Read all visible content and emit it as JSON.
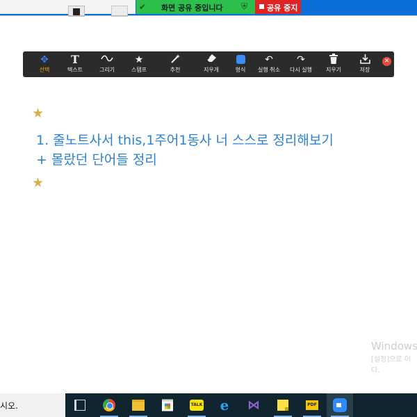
{
  "top_bar": {
    "share_status": "화면 공유 중입니다",
    "stop_share_label": "공유 중지",
    "colors": {
      "share_green": "#2dbf4b",
      "stop_red": "#e02424",
      "window_blue": "#0a6fd8"
    }
  },
  "toolbar": {
    "tools": [
      {
        "name": "tool-select",
        "icon": "move-icon",
        "label": "선택",
        "active": true
      },
      {
        "name": "tool-text",
        "icon": "text-t-icon",
        "label": "텍스트"
      },
      {
        "name": "tool-draw",
        "icon": "squiggle-icon",
        "label": "그리기"
      },
      {
        "name": "tool-stamp",
        "icon": "star-icon",
        "label": "스탬프"
      },
      {
        "name": "tool-spotlight",
        "icon": "wand-icon",
        "label": "추천"
      },
      {
        "name": "tool-eraser",
        "icon": "eraser-icon",
        "label": "지우개"
      },
      {
        "name": "tool-format",
        "icon": "color-square-icon",
        "label": "형식"
      },
      {
        "name": "tool-undo",
        "icon": "undo-icon",
        "label": "실행 취소"
      },
      {
        "name": "tool-redo",
        "icon": "redo-icon",
        "label": "다시 실행"
      },
      {
        "name": "tool-clear",
        "icon": "trash-icon",
        "label": "지우기"
      },
      {
        "name": "tool-save",
        "icon": "download-icon",
        "label": "저장"
      }
    ],
    "close_icon": "close-icon",
    "accent_color": "#f4a31c"
  },
  "content": {
    "line1": "1. 줄노트사서 this,1주어1동사 너 스스로 정리해보기",
    "line2": "+ 몰랐던 단어들 정리",
    "text_color": "#2b82d9",
    "star_color": "#d6b04a"
  },
  "watermark": {
    "title": "Windows",
    "line1": "[설정]으로 이",
    "line2": "다."
  },
  "taskbar": {
    "search_text": "시오.",
    "apps": [
      "task-view-icon",
      "chrome-icon",
      "file-explorer-icon",
      "store-icon",
      "kakaotalk-icon",
      "internet-explorer-icon",
      "visual-studio-icon",
      "sticky-notes-icon",
      "pdf-icon",
      "zoom-icon"
    ],
    "kakaotalk_text": "TALK",
    "pdf_text": "PDF"
  }
}
